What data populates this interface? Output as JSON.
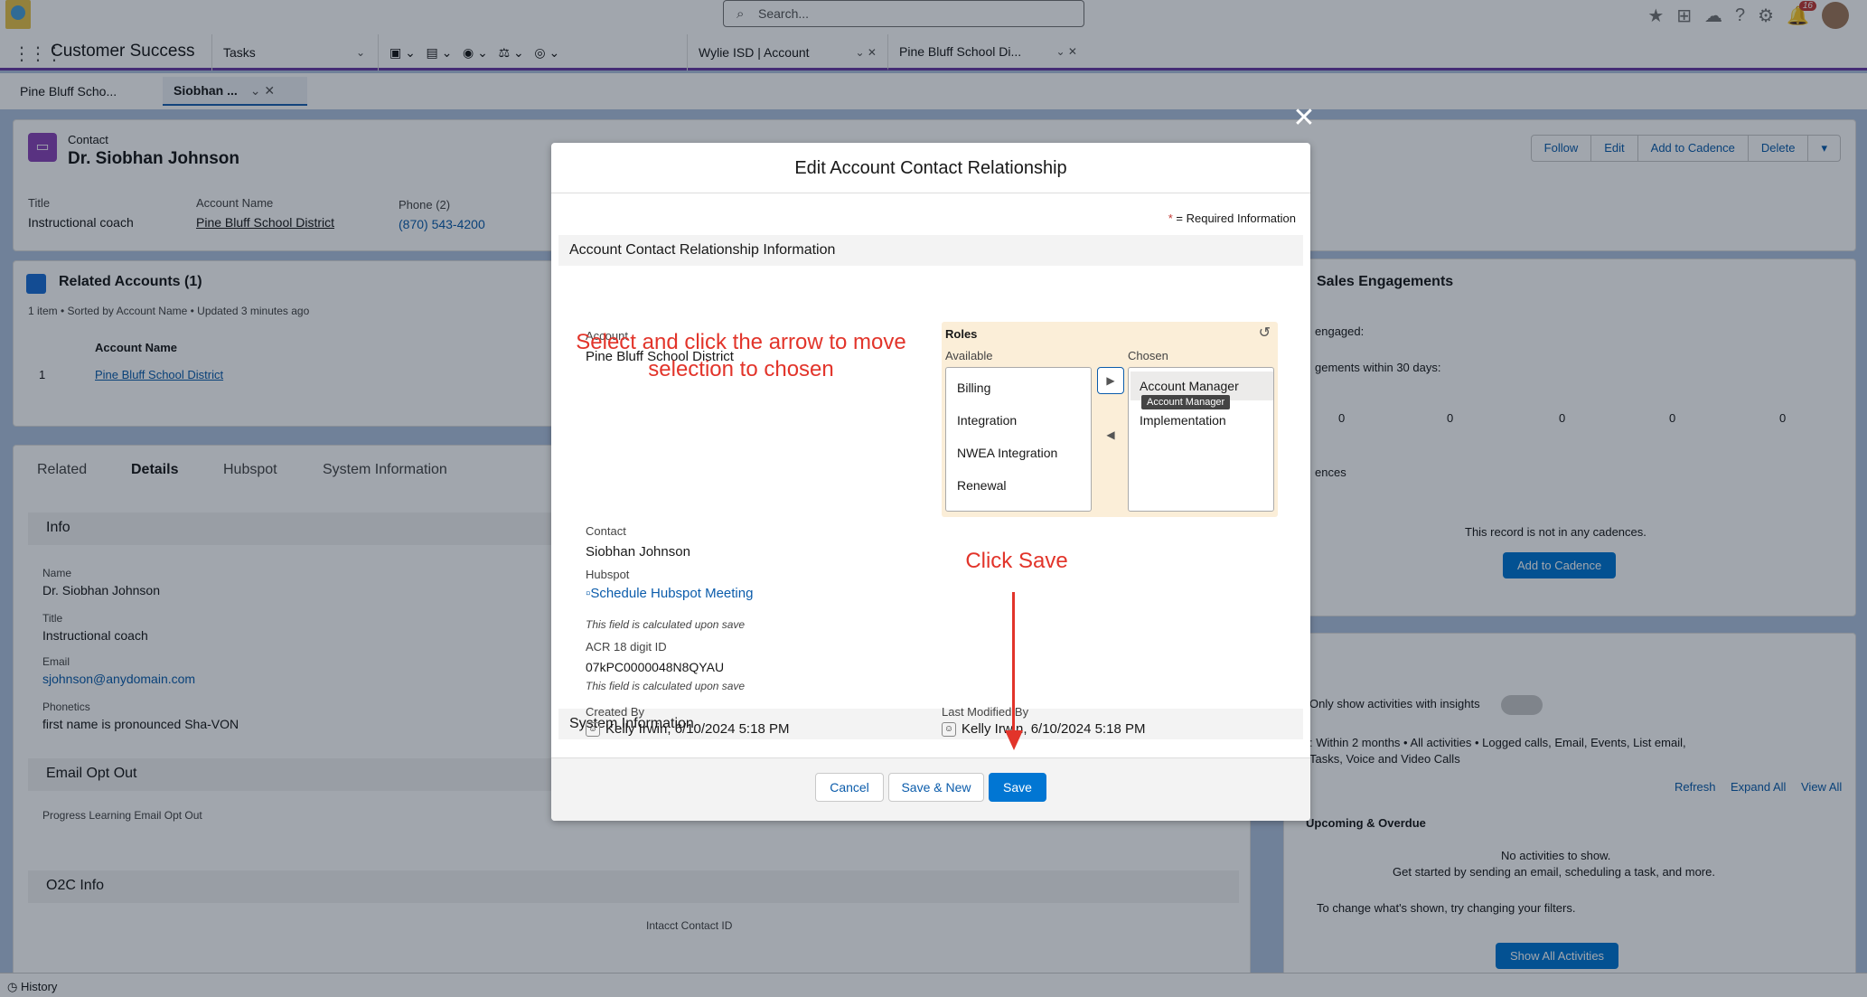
{
  "global": {
    "search_placeholder": "Search...",
    "notification_count": "16"
  },
  "nav": {
    "app_name": "Customer Success",
    "items": [
      {
        "label": "Tasks"
      },
      {
        "label": "Wylie ISD | Account"
      },
      {
        "label": "Pine Bluff School Di..."
      }
    ]
  },
  "subtabs": [
    {
      "label": "Pine Bluff Scho..."
    },
    {
      "label": "Siobhan ..."
    }
  ],
  "contact": {
    "type": "Contact",
    "name": "Dr. Siobhan Johnson",
    "title_label": "Title",
    "title_value": "Instructional coach",
    "account_label": "Account Name",
    "account_value": "Pine Bluff School District",
    "phone_label": "Phone (2)",
    "phone_value": "(870) 543-4200",
    "actions": [
      "Follow",
      "Edit",
      "Add to Cadence",
      "Delete"
    ]
  },
  "related": {
    "title": "Related Accounts (1)",
    "meta": "1 item • Sorted by Account Name • Updated 3 minutes ago",
    "col": "Account Name",
    "row_num": "1",
    "row_value": "Pine Bluff School District"
  },
  "details": {
    "tabs": [
      "Related",
      "Details",
      "Hubspot",
      "System Information"
    ],
    "info_section": "Info",
    "fields": [
      {
        "label": "Name",
        "value": "Dr. Siobhan Johnson"
      },
      {
        "label": "Title",
        "value": "Instructional coach"
      },
      {
        "label": "Email",
        "value": "sjohnson@anydomain.com"
      },
      {
        "label": "Phonetics",
        "value": "first name is pronounced Sha-VON"
      }
    ],
    "email_opt_out": "Email Opt Out",
    "opt_out_field": "Progress Learning Email Opt Out",
    "o2c": "O2C Info",
    "intacct": "Intacct Contact ID"
  },
  "sales": {
    "title": "Sales Engagements",
    "engaged": "engaged:",
    "within": "gements within 30 days:",
    "counts": [
      "0",
      "0",
      "0",
      "0",
      "0"
    ],
    "cadences": "ences",
    "not_in": "This record is not in any cadences.",
    "add_btn": "Add to Cadence"
  },
  "activity": {
    "only_show": "Only show activities with insights",
    "filters": ": Within 2 months • All activities • Logged calls, Email, Events, List email, Tasks, Voice and Video Calls",
    "refresh": "Refresh",
    "expand": "Expand All",
    "view_all": "View All",
    "upcoming": "Upcoming & Overdue",
    "no_act": "No activities to show.",
    "get_started": "Get started by sending an email, scheduling a task, and more.",
    "change_filters": "To change what's shown, try changing your filters.",
    "show_all": "Show All Activities"
  },
  "bottom": {
    "history": "History"
  },
  "modal": {
    "title": "Edit Account Contact Relationship",
    "required_note": "= Required Information",
    "section_info": "Account Contact Relationship Information",
    "account_label": "Account",
    "account_value": "Pine Bluff School District",
    "roles_label": "Roles",
    "available_label": "Available",
    "chosen_label": "Chosen",
    "available": [
      "Billing",
      "Integration",
      "NWEA Integration",
      "Renewal"
    ],
    "chosen": [
      "Account Manager",
      "Implementation"
    ],
    "tooltip": "Account Manager",
    "contact_label": "Contact",
    "contact_value": "Siobhan Johnson",
    "hubspot_label": "Hubspot",
    "hubspot_link": "Schedule Hubspot Meeting",
    "calc_note": "This field is calculated upon save",
    "acr_label": "ACR 18 digit ID",
    "acr_value": "07kPC0000048N8QYAU",
    "calc_note2": "This field is calculated upon save",
    "section_system": "System Information",
    "created_label": "Created By",
    "created_user": "Kelly Irwin",
    "created_date": ", 6/10/2024 5:18 PM",
    "modified_label": "Last Modified By",
    "modified_user": "Kelly Irwin",
    "modified_date": ", 6/10/2024 5:18 PM",
    "buttons": {
      "cancel": "Cancel",
      "save_new": "Save & New",
      "save": "Save"
    }
  },
  "annotations": {
    "select_arrow": "Select and click the arrow to move selection to chosen",
    "click_save": "Click Save",
    "color": "#e2342a"
  }
}
